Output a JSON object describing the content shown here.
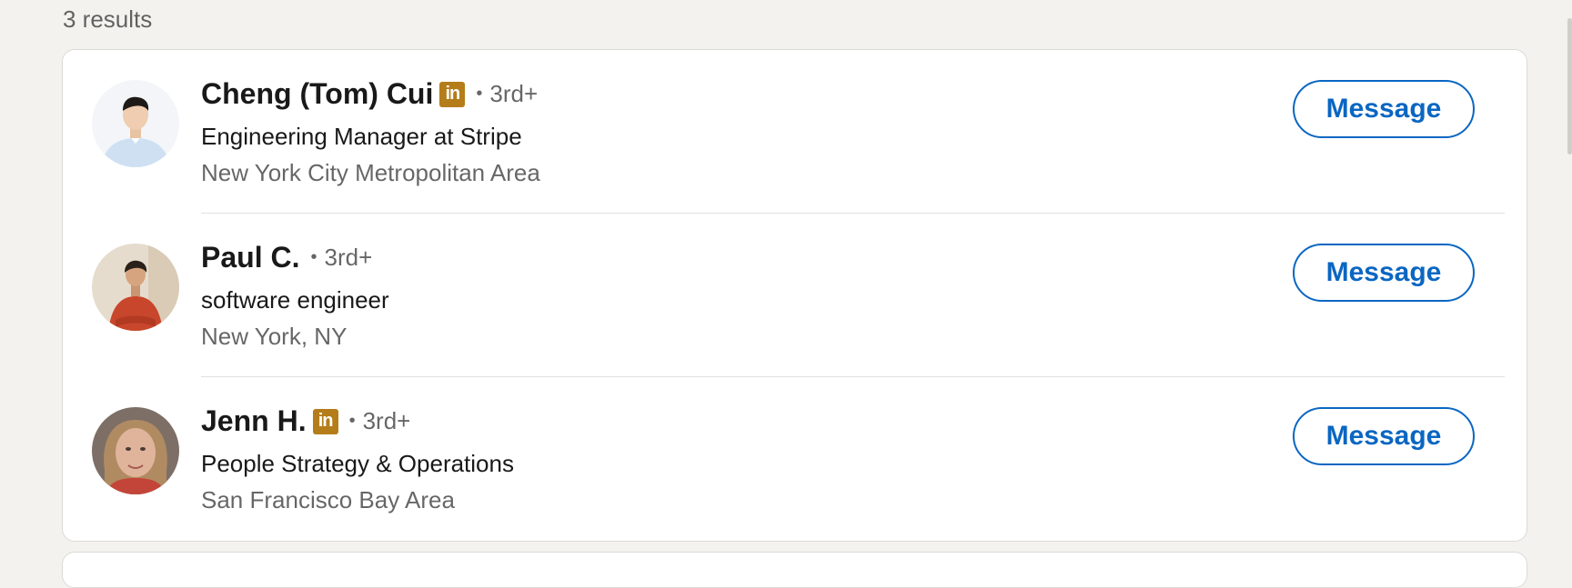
{
  "results_count": "3 results",
  "badge_text": "in",
  "separator": "•",
  "accent_color": "#0a66c2",
  "premium_badge_color": "#b47d1a",
  "people": [
    {
      "name": "Cheng (Tom) Cui",
      "has_badge": true,
      "degree": "3rd+",
      "headline": "Engineering Manager at Stripe",
      "location": "New York City Metropolitan Area",
      "action_label": "Message"
    },
    {
      "name": "Paul C.",
      "has_badge": false,
      "degree": "3rd+",
      "headline": "software engineer",
      "location": "New York, NY",
      "action_label": "Message"
    },
    {
      "name": "Jenn H.",
      "has_badge": true,
      "degree": "3rd+",
      "headline": "People Strategy & Operations",
      "location": "San Francisco Bay Area",
      "action_label": "Message"
    }
  ]
}
